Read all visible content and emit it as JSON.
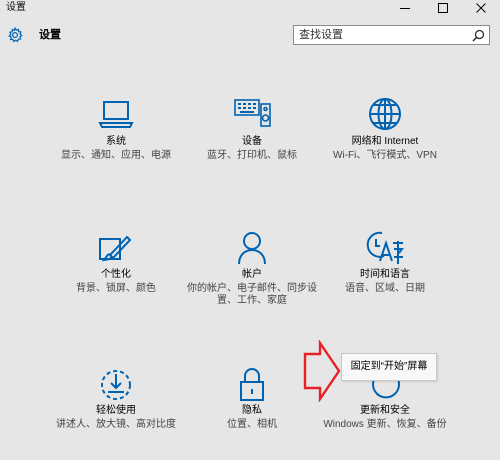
{
  "window": {
    "title": "设置"
  },
  "header": {
    "icon": "gear-icon",
    "title": "设置"
  },
  "search": {
    "placeholder": "查找设置",
    "icon": "search-icon"
  },
  "colors": {
    "accent": "#0063b1",
    "background": "#e6e6e6",
    "annotation": "#e62226"
  },
  "tiles": [
    {
      "icon": "laptop-icon",
      "title": "系统",
      "description": "显示、通知、应用、电源"
    },
    {
      "icon": "keyboard-speaker-icon",
      "title": "设备",
      "description": "蓝牙、打印机、鼠标"
    },
    {
      "icon": "globe-icon",
      "title": "网络和 Internet",
      "description": "Wi-Fi、飞行模式、VPN"
    },
    {
      "icon": "paint-brush-icon",
      "title": "个性化",
      "description": "背景、锁屏、颜色"
    },
    {
      "icon": "person-icon",
      "title": "帐户",
      "description": "你的帐户、电子邮件、同步设置、工作、家庭"
    },
    {
      "icon": "clock-language-icon",
      "title": "时间和语言",
      "description": "语音、区域、日期"
    },
    {
      "icon": "ease-of-access-icon",
      "title": "轻松使用",
      "description": "讲述人、放大镜、高对比度"
    },
    {
      "icon": "lock-icon",
      "title": "隐私",
      "description": "位置、相机"
    },
    {
      "icon": "refresh-icon",
      "title": "更新和安全",
      "description": "Windows 更新、恢复、备份"
    }
  ],
  "tooltip": {
    "text": "固定到“开始”屏幕"
  }
}
